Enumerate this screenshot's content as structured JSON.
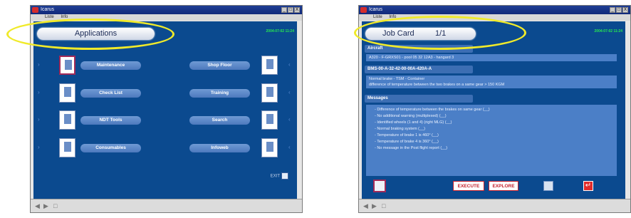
{
  "window1": {
    "title": "Icarus",
    "menu": [
      "Liste",
      "Info"
    ],
    "controls": [
      "_",
      "□",
      "X"
    ],
    "header": "Applications",
    "green_text": "2004-07-02 11:24",
    "left_modules": [
      "Maintenance",
      "Check List",
      "NDT Tools",
      "Consumables"
    ],
    "right_modules": [
      "Shop Floor",
      "Training",
      "Search",
      "Infoweb"
    ],
    "exit_label": "EXIT",
    "status_icons": [
      "◀",
      "▶",
      "□"
    ]
  },
  "window2": {
    "title": "Icarus",
    "menu": [
      "Liste",
      "Info"
    ],
    "controls": [
      "_",
      "□",
      "X"
    ],
    "header": "Job Card",
    "header_count": "1/1",
    "green_text": "2004-07-02 11:24",
    "aircraft_label": "Aircraft",
    "aircraft_value": "A320 - F-GRXS01 - pool 05 32 12A3 - hangard 3",
    "code_label": "BMS-00-A-32-42-00-00A-420A-A",
    "code_lines": [
      "Normal brake - TSM - Container",
      "difference of temperature between the two brakes on a same gear > 150 KGM"
    ],
    "messages_label": "Messages",
    "messages": [
      "- Difference of temperature between the brakes on same gear (__)",
      "- No additional warning (multiplexed) (__)",
      "- Identified wheels (1 and 4) (right MLG) (__)",
      "- Normal braking system (__)",
      "- Temperature of brake 1 is 460° (__)",
      "- Temperature of brake 4 is 360° (__)",
      "- No message in the Post flight report (__)"
    ],
    "execute_label": "EXECUTE",
    "explore_label": "EXPLORE",
    "status_icons": [
      "◀",
      "▶",
      "□"
    ]
  },
  "colors": {
    "panel_blue": "#0b4a8f",
    "highlight_yellow": "#f0ea2a",
    "action_red": "#c41f2b",
    "clock_green": "#27e94f"
  }
}
